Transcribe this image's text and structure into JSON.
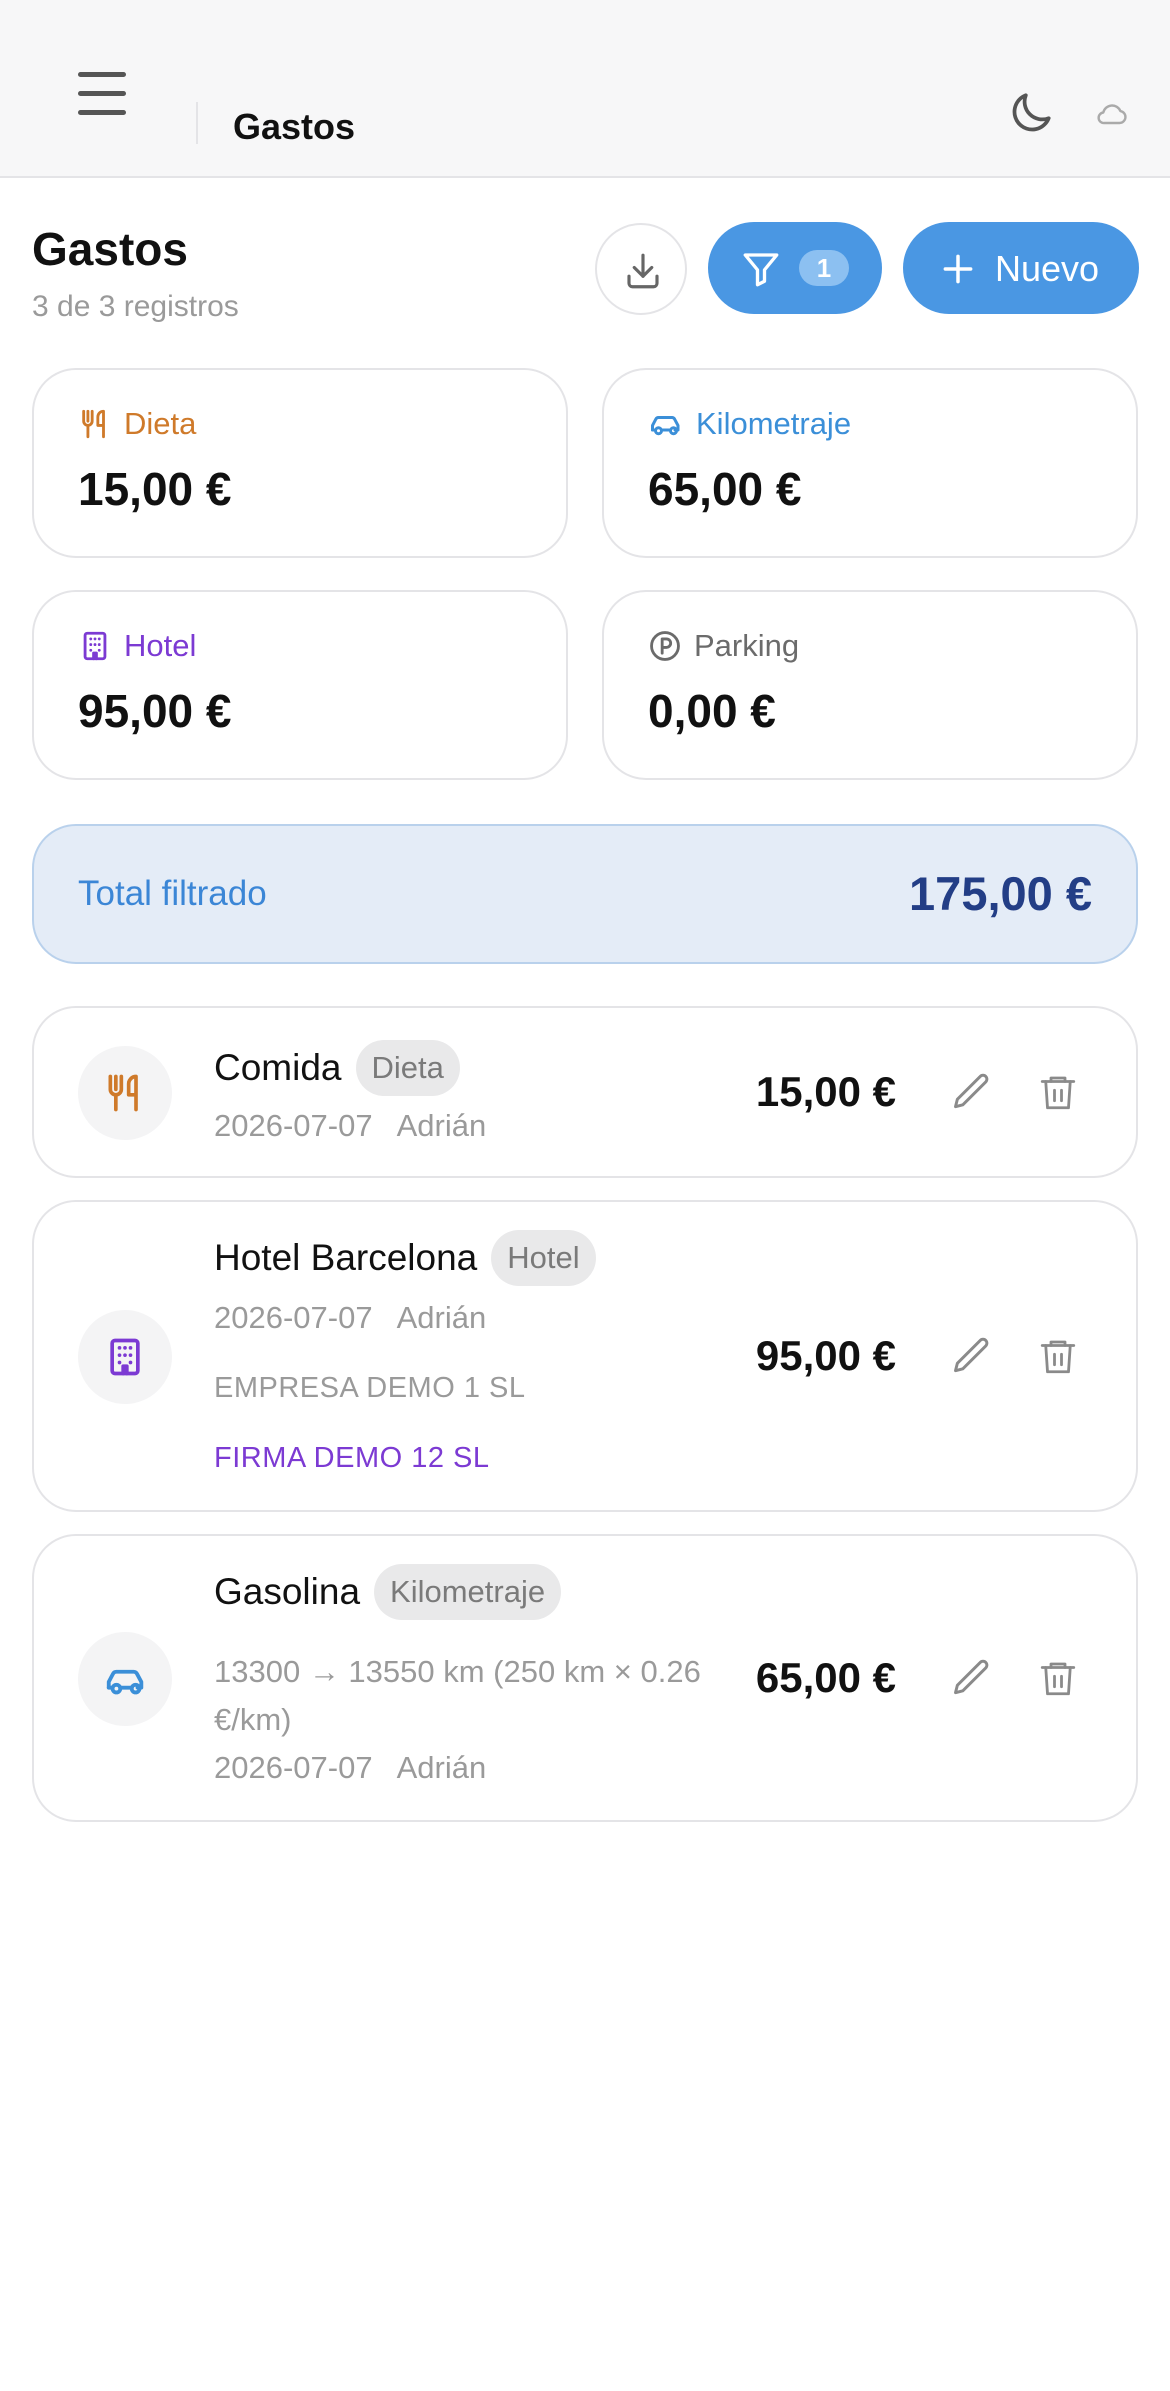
{
  "topbar": {
    "title": "Gastos",
    "icons": [
      "menu-icon",
      "moon-icon",
      "cloud-icon"
    ]
  },
  "header": {
    "title": "Gastos",
    "subtitle": "3 de 3 registros",
    "filter_count": "1",
    "new_label": "Nuevo"
  },
  "stats": [
    {
      "label": "Dieta",
      "value": "15,00 €",
      "icon": "utensils-icon",
      "color": "#cf7a2a"
    },
    {
      "label": "Kilometraje",
      "value": "65,00 €",
      "icon": "car-icon",
      "color": "#3b8fd8"
    },
    {
      "label": "Hotel",
      "value": "95,00 €",
      "icon": "building-icon",
      "color": "#7c3ad3"
    },
    {
      "label": "Parking",
      "value": "0,00 €",
      "icon": "parking-icon",
      "color": "#6b6b6b"
    }
  ],
  "total": {
    "label": "Total filtrado",
    "value": "175,00 €"
  },
  "items": [
    {
      "title": "Comida",
      "tag": "Dieta",
      "date": "2026-07-07",
      "user": "Adrián",
      "amount": "15,00 €",
      "icon": "utensils-icon"
    },
    {
      "title": "Hotel Barcelona",
      "tag": "Hotel",
      "date": "2026-07-07",
      "user": "Adrián",
      "company": "EMPRESA DEMO 1 SL",
      "firma": "FIRMA DEMO 12 SL",
      "amount": "95,00 €",
      "icon": "building-icon"
    },
    {
      "title": "Gasolina",
      "tag": "Kilometraje",
      "desc": "13300 → 13550 km (250 km × 0.26 €/km)",
      "date": "2026-07-07",
      "user": "Adrián",
      "amount": "65,00 €",
      "icon": "car-icon"
    }
  ]
}
